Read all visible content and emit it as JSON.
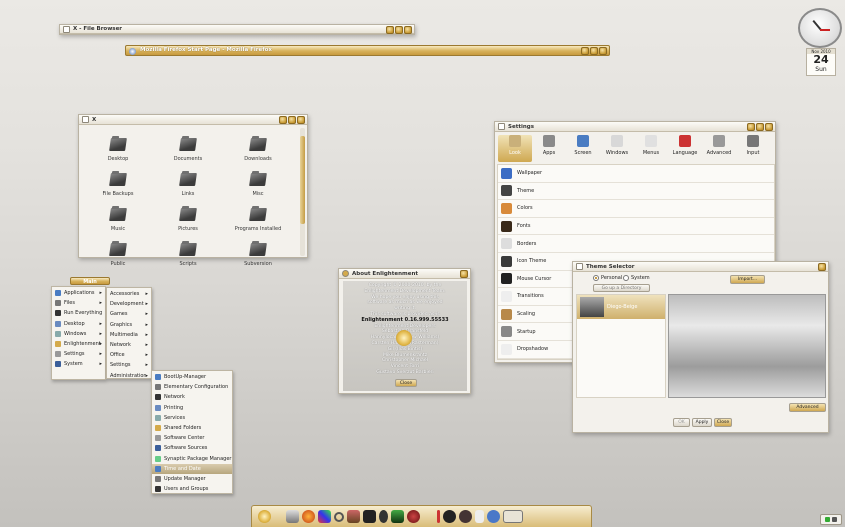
{
  "file_browser_bar": {
    "title": "X - File Browser"
  },
  "firefox_bar": {
    "title": "Mozilla Firefox Start Page - Mozilla Firefox"
  },
  "folder_window": {
    "title": "X",
    "items": [
      "Desktop",
      "Documents",
      "Downloads",
      "File Backups",
      "Links",
      "Misc",
      "Music",
      "Pictures",
      "Programs Installed",
      "Public",
      "Scripts",
      "Subversion"
    ]
  },
  "clock": {
    "month": "Nov 2010",
    "day": "24",
    "weekday": "Sun"
  },
  "main_menu": {
    "header": "Main",
    "items": [
      {
        "label": "Applications",
        "arrow": true
      },
      {
        "label": "Files",
        "arrow": true
      },
      {
        "label": "Run Everything",
        "arrow": false
      },
      {
        "label": "Desktop",
        "arrow": true
      },
      {
        "label": "Windows",
        "arrow": true
      },
      {
        "label": "Enlightenment",
        "arrow": true
      },
      {
        "label": "Settings",
        "arrow": true
      },
      {
        "label": "System",
        "arrow": true
      }
    ]
  },
  "apps_menu": {
    "items": [
      {
        "label": "Accessories",
        "arrow": true
      },
      {
        "label": "Development",
        "arrow": true
      },
      {
        "label": "Games",
        "arrow": true
      },
      {
        "label": "Graphics",
        "arrow": true
      },
      {
        "label": "Multimedia",
        "arrow": true
      },
      {
        "label": "Network",
        "arrow": true
      },
      {
        "label": "Office",
        "arrow": true
      },
      {
        "label": "Settings",
        "arrow": true
      },
      {
        "label": "Administration",
        "arrow": true
      }
    ]
  },
  "admin_menu": {
    "items": [
      "BootUp-Manager",
      "Elementary Configuration",
      "Network",
      "Printing",
      "Services",
      "Shared Folders",
      "Software Center",
      "Software Sources",
      "Synaptic Package Manager",
      "Time and Date",
      "Update Manager",
      "Users and Groups"
    ],
    "selected_index": 9
  },
  "about_window": {
    "title": "About Enlightenment",
    "lines": [
      "Copyright © 2000-2010, by the",
      "Enlightenment Development Team.",
      "",
      "We hope you enjoy using this",
      "software as much as we enjoyed",
      "writing it.",
      "",
      "This software is provided as-is",
      "Enlightenment 0.16.999.55533",
      "Enlightenment Developers",
      "Sebastian Dransfeld",
      "Hannylocal (Andrew Williams)",
      "Carsten Haitzler (Rasterman)",
      "Gil (Ilias Bintis)",
      "Mike Blumenkrantz",
      "Christopher Michael",
      "Vincent Torri",
      "Gustavo Sverzut Barbieri"
    ],
    "close_label": "Close"
  },
  "settings_window": {
    "title": "Settings",
    "categories": [
      "Look",
      "Apps",
      "Screen",
      "Windows",
      "Menus",
      "Language",
      "Advanced",
      "Input"
    ],
    "selected_category": 0,
    "items": [
      "Wallpaper",
      "Theme",
      "Colors",
      "Fonts",
      "Borders",
      "Icon Theme",
      "Mouse Cursor",
      "Transitions",
      "Scaling",
      "Startup",
      "Dropshadow"
    ]
  },
  "theme_window": {
    "title": "Theme Selector",
    "radio_personal": "Personal",
    "radio_system": "System",
    "go_up_label": "Go up a Directory",
    "import_label": "Import...",
    "theme_name": "Diego-Beige",
    "advanced_label": "Advanced",
    "ok_label": "OK",
    "apply_label": "Apply",
    "close_label": "Close"
  },
  "colors": {
    "gold_light": "#f8eac0",
    "gold": "#d7b15a",
    "gold_dark": "#9b7930",
    "selection": "#b7a67e"
  }
}
